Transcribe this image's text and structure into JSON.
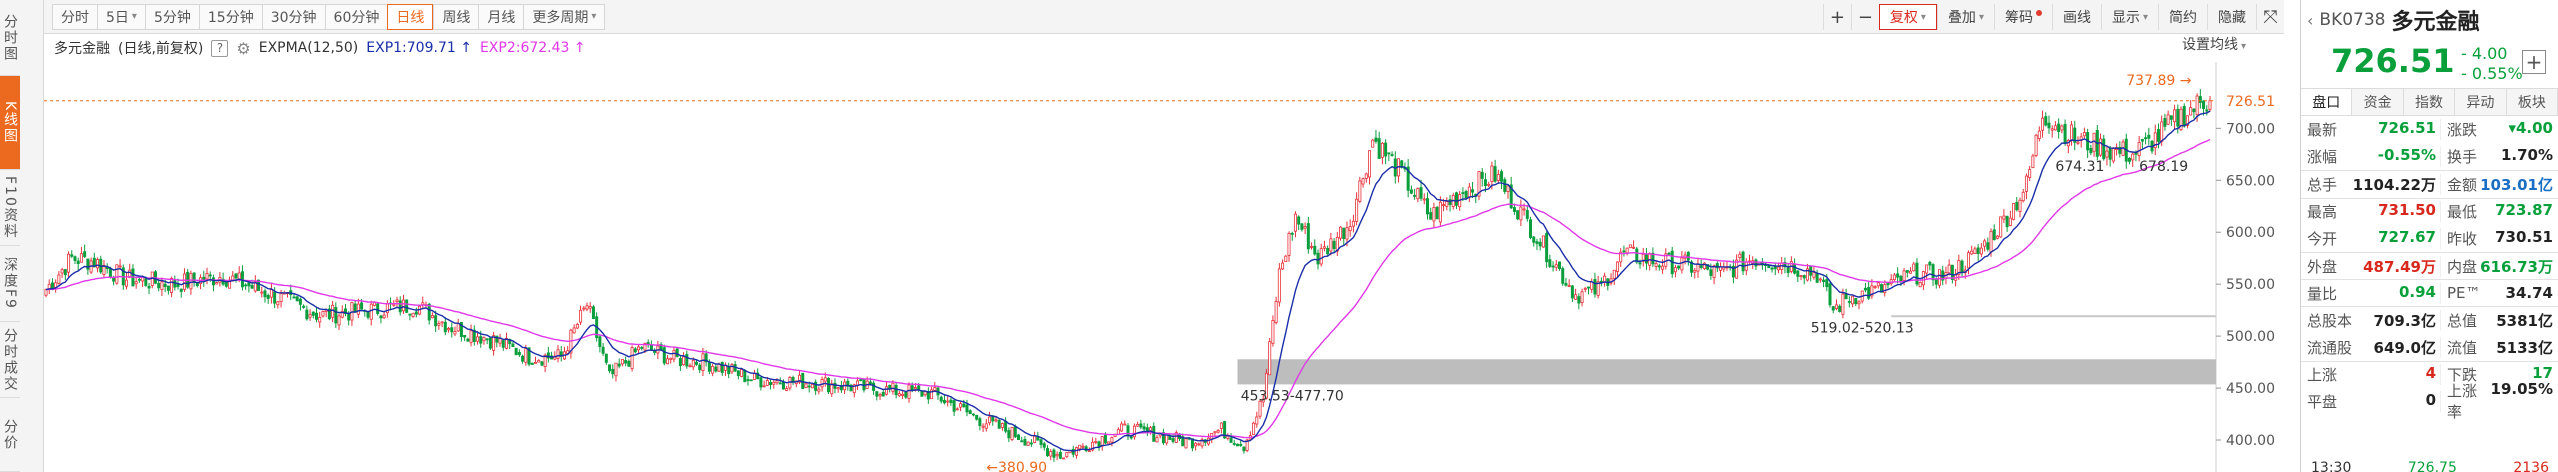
{
  "left_tabs": [
    {
      "label": "分时图",
      "active": false,
      "height": 76
    },
    {
      "label": "K线图",
      "active": true,
      "height": 94
    },
    {
      "label": "F10资料",
      "active": false,
      "height": 76
    },
    {
      "label": "深度F9",
      "active": false,
      "height": 76
    },
    {
      "label": "分时成交",
      "active": false,
      "height": 76
    },
    {
      "label": "分价",
      "active": false,
      "height": 74
    }
  ],
  "periods": [
    {
      "label": "分时",
      "active": false,
      "caret": false
    },
    {
      "label": "5日",
      "active": false,
      "caret": true
    },
    {
      "label": "5分钟",
      "active": false,
      "caret": false
    },
    {
      "label": "15分钟",
      "active": false,
      "caret": false
    },
    {
      "label": "30分钟",
      "active": false,
      "caret": false
    },
    {
      "label": "60分钟",
      "active": false,
      "caret": false
    },
    {
      "label": "日线",
      "active": true,
      "caret": false
    },
    {
      "label": "周线",
      "active": false,
      "caret": false
    },
    {
      "label": "月线",
      "active": false,
      "caret": false
    },
    {
      "label": "更多周期",
      "active": false,
      "caret": true
    }
  ],
  "toolbar_right": {
    "plus": "+",
    "minus": "−",
    "fuquan": "复权",
    "diejia": "叠加",
    "chouma": "筹码",
    "huaxian": "画线",
    "xianshi": "显示",
    "jianyue": "简约",
    "yincang": "隐藏",
    "expand": "⤧"
  },
  "indicator": {
    "name": "多元金融",
    "mode": "(日线,前复权)",
    "help": "?",
    "label": "EXPMA(12,50)",
    "exp1": "EXP1:709.71",
    "exp2": "EXP2:672.43",
    "settings": "设置均线"
  },
  "colors": {
    "up": "#e8313a",
    "down": "#0a9e3c",
    "exp1": "#1a2ea8",
    "exp2": "#e038e8",
    "accent": "#ec6a20",
    "price_green": "#09a03b"
  },
  "chart_data": {
    "type": "candlestick",
    "ylim": [
      375,
      760
    ],
    "yticks": [
      "400.00",
      "450.00",
      "500.00",
      "550.00",
      "600.00",
      "650.00",
      "700.00"
    ],
    "last_price_label": "726.51",
    "annotations": {
      "high": "737.89",
      "low": "380.90",
      "support_zone": "453.53-477.70",
      "zone2": "519.02-520.13",
      "recent_low": "674.31",
      "recent_low2": "678.19"
    },
    "zones": [
      {
        "y0": 453.53,
        "y1": 477.7
      },
      {
        "y0": 519.02,
        "y1": 520.13
      }
    ],
    "anchors": [
      [
        0,
        545
      ],
      [
        8,
        575
      ],
      [
        15,
        572
      ],
      [
        25,
        555
      ],
      [
        40,
        550
      ],
      [
        55,
        558
      ],
      [
        70,
        540
      ],
      [
        85,
        520
      ],
      [
        100,
        525
      ],
      [
        115,
        530
      ],
      [
        125,
        510
      ],
      [
        140,
        495
      ],
      [
        150,
        480
      ],
      [
        160,
        480
      ],
      [
        168,
        530
      ],
      [
        175,
        460
      ],
      [
        185,
        490
      ],
      [
        195,
        478
      ],
      [
        205,
        475
      ],
      [
        220,
        458
      ],
      [
        240,
        455
      ],
      [
        260,
        448
      ],
      [
        275,
        445
      ],
      [
        290,
        420
      ],
      [
        305,
        400
      ],
      [
        315,
        385
      ],
      [
        325,
        398
      ],
      [
        335,
        410
      ],
      [
        345,
        405
      ],
      [
        355,
        398
      ],
      [
        365,
        410
      ],
      [
        372,
        395
      ],
      [
        378,
        440
      ],
      [
        383,
        560
      ],
      [
        388,
        615
      ],
      [
        395,
        575
      ],
      [
        405,
        610
      ],
      [
        412,
        690
      ],
      [
        420,
        660
      ],
      [
        430,
        615
      ],
      [
        440,
        640
      ],
      [
        450,
        655
      ],
      [
        460,
        610
      ],
      [
        468,
        572
      ],
      [
        475,
        540
      ],
      [
        482,
        545
      ],
      [
        490,
        580
      ],
      [
        500,
        572
      ],
      [
        510,
        568
      ],
      [
        520,
        560
      ],
      [
        530,
        575
      ],
      [
        540,
        570
      ],
      [
        550,
        560
      ],
      [
        555,
        525
      ],
      [
        560,
        538
      ],
      [
        570,
        545
      ],
      [
        580,
        560
      ],
      [
        590,
        558
      ],
      [
        600,
        580
      ],
      [
        610,
        620
      ],
      [
        615,
        645
      ],
      [
        620,
        715
      ],
      [
        630,
        690
      ],
      [
        640,
        680
      ],
      [
        648,
        675
      ],
      [
        655,
        690
      ],
      [
        662,
        710
      ],
      [
        668,
        722
      ],
      [
        672,
        726.51
      ]
    ]
  },
  "quote": {
    "code": "BK0738",
    "name": "多元金融",
    "price": "726.51",
    "change": "- 4.00",
    "change_pct": "- 0.55%",
    "add": "+",
    "tabs": [
      "盘口",
      "资金",
      "指数",
      "异动",
      "板块"
    ],
    "rows": [
      {
        "l_label": "最新",
        "l_val": "726.51",
        "l_cls": "green",
        "r_label": "涨跌",
        "r_val": "▾4.00",
        "r_cls": "green",
        "sep": false
      },
      {
        "l_label": "涨幅",
        "l_val": "-0.55%",
        "l_cls": "green",
        "r_label": "换手",
        "r_val": "1.70%",
        "r_cls": "black",
        "sep": false
      },
      {
        "l_label": "总手",
        "l_val": "1104.22万",
        "l_cls": "black",
        "r_label": "金额",
        "r_val": "103.01亿",
        "r_cls": "blue",
        "sep": true
      },
      {
        "l_label": "最高",
        "l_val": "731.50",
        "l_cls": "red",
        "r_label": "最低",
        "r_val": "723.87",
        "r_cls": "green",
        "sep": true
      },
      {
        "l_label": "今开",
        "l_val": "727.67",
        "l_cls": "green",
        "r_label": "昨收",
        "r_val": "730.51",
        "r_cls": "black",
        "sep": false
      },
      {
        "l_label": "外盘",
        "l_val": "487.49万",
        "l_cls": "red",
        "r_label": "内盘",
        "r_val": "616.73万",
        "r_cls": "green",
        "sep": true
      },
      {
        "l_label": "量比",
        "l_val": "0.94",
        "l_cls": "green",
        "r_label": "PE™",
        "r_val": "34.74",
        "r_cls": "black",
        "sep": true
      },
      {
        "l_label": "总股本",
        "l_val": "709.3亿",
        "l_cls": "black",
        "r_label": "总值",
        "r_val": "5381亿",
        "r_cls": "black",
        "sep": true
      },
      {
        "l_label": "流通股",
        "l_val": "649.0亿",
        "l_cls": "black",
        "r_label": "流值",
        "r_val": "5133亿",
        "r_cls": "black",
        "sep": false
      },
      {
        "l_label": "上涨",
        "l_val": "4",
        "l_cls": "red",
        "r_label": "下跌",
        "r_val": "17",
        "r_cls": "green",
        "sep": true
      },
      {
        "l_label": "平盘",
        "l_val": "0",
        "l_cls": "black",
        "r_label": "上涨率",
        "r_val": "19.05%",
        "r_cls": "black",
        "sep": false
      }
    ],
    "bottom": {
      "time": "13:30",
      "price": "726.75",
      "vol": "2136"
    }
  }
}
